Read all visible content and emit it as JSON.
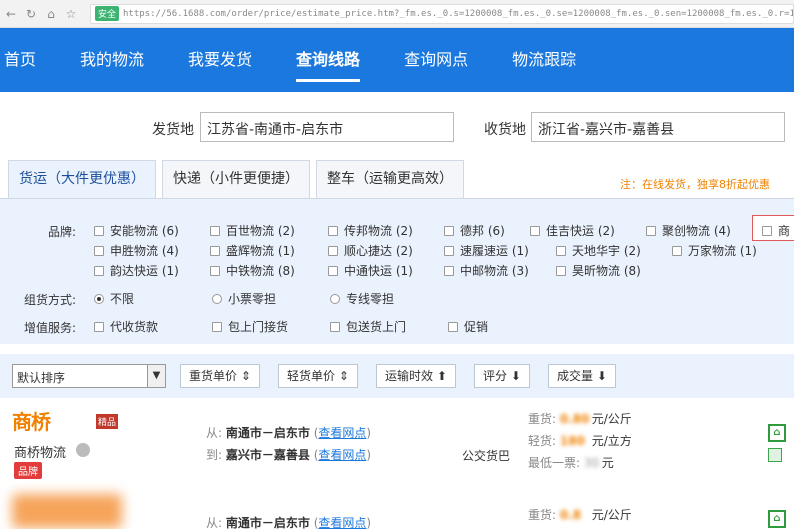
{
  "browser": {
    "badge": "安全",
    "url": "https://56.1688.com/order/price/estimate_price.htm?_fm.es._0.s=1200008_fm.es._0.se=1200008_fm.es._0.sen=1200008_fm.es._0.r=1300008_fm.es._0.c=1304008"
  },
  "nav": {
    "items": [
      "首页",
      "我的物流",
      "我要发货",
      "查询线路",
      "查询网点",
      "物流跟踪"
    ]
  },
  "origin": {
    "label": "发货地",
    "value": "江苏省-南通市-启东市"
  },
  "destination": {
    "label": "收货地",
    "value": "浙江省-嘉兴市-嘉善县"
  },
  "tabs": [
    "货运（大件更优惠）",
    "快递（小件更便捷）",
    "整车（运输更高效）"
  ],
  "promo": "注：在线发货，独享8折起优惠",
  "filters": {
    "brand_label": "品牌:",
    "brands_row1": [
      "安能物流 (6)",
      "百世物流 (2)",
      "传邦物流 (2)",
      "德邦 (6)",
      "佳吉快运 (2)",
      "聚创物流 (4)",
      "商"
    ],
    "brands_row2": [
      "申胜物流 (4)",
      "盛辉物流 (1)",
      "顺心捷达 (2)",
      "速履速运 (1)",
      "天地华宇 (2)",
      "万家物流 (1)"
    ],
    "brands_row3": [
      "韵达快运 (1)",
      "中铁物流 (8)",
      "中通快运 (1)",
      "中邮物流 (3)",
      "昊昕物流 (8)"
    ],
    "mode_label": "组货方式:",
    "modes": [
      "不限",
      "小票零担",
      "专线零担"
    ],
    "service_label": "增值服务:",
    "services": [
      "代收货款",
      "包上门接货",
      "包送货上门",
      "促销"
    ]
  },
  "sort": {
    "select": "默认排序",
    "buttons": [
      "重货单价 ⇕",
      "轻货单价 ⇕",
      "运输时效 ⬆",
      "评分 ⬇",
      "成交量 ⬇"
    ]
  },
  "results": [
    {
      "logo": "商桥",
      "logo_sub": "精品",
      "name": "商桥物流",
      "badge": "品牌",
      "from_label": "从:",
      "from_city": "南通市－启东市",
      "to_label": "到:",
      "to_city": "嘉兴市－嘉善县",
      "view": "查看网点",
      "vehicle": "公交货巴",
      "heavy_label": "重货:",
      "heavy_value": "0.80",
      "heavy_unit": "元/公斤",
      "light_label": "轻货:",
      "light_value": "180",
      "light_unit": "元/立方",
      "min_label": "最低一票:",
      "min_value": "30",
      "min_unit": "元"
    },
    {
      "from_label": "从:",
      "from_city": "南通市－启东市",
      "view": "查看网点",
      "heavy_label": "重货:",
      "heavy_value": "0.8",
      "heavy_unit": "元/公斤"
    }
  ],
  "colors": {
    "nav_bg": "#1b78de",
    "panel_bg": "#eaf2fd",
    "accent_orange": "#f08200",
    "badge_red": "#e23c3c"
  }
}
